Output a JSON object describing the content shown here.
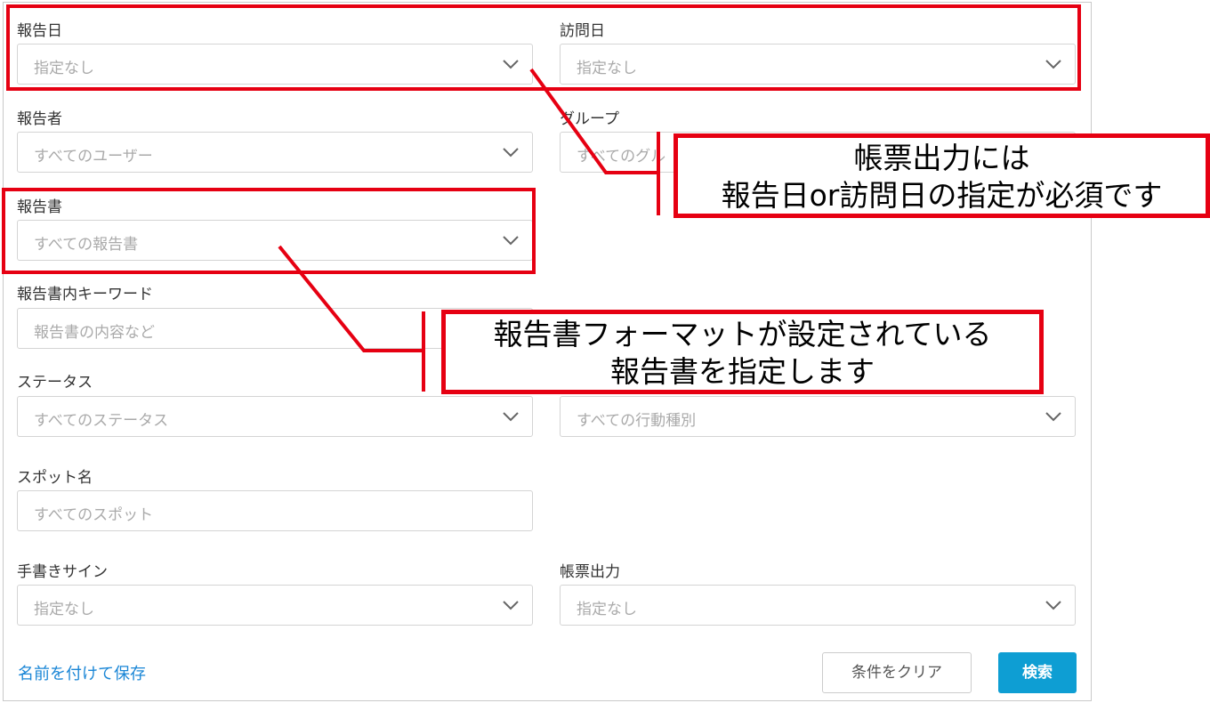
{
  "fields": {
    "report_date": {
      "label": "報告日",
      "placeholder": "指定なし"
    },
    "visit_date": {
      "label": "訪問日",
      "placeholder": "指定なし"
    },
    "reporter": {
      "label": "報告者",
      "placeholder": "すべてのユーザー"
    },
    "group": {
      "label": "グループ",
      "placeholder": "すべてのグル"
    },
    "report": {
      "label": "報告書",
      "placeholder": "すべての報告書"
    },
    "keyword": {
      "label": "報告書内キーワード",
      "placeholder": "報告書の内容など"
    },
    "status": {
      "label": "ステータス",
      "placeholder": "すべてのステータス"
    },
    "action_type": {
      "placeholder": "すべての行動種別"
    },
    "spot_name": {
      "label": "スポット名",
      "placeholder": "すべてのスポット"
    },
    "signature": {
      "label": "手書きサイン",
      "placeholder": "指定なし"
    },
    "form_output": {
      "label": "帳票出力",
      "placeholder": "指定なし"
    }
  },
  "actions": {
    "save_named": "名前を付けて保存",
    "clear": "条件をクリア",
    "search": "検索"
  },
  "annotations": {
    "date_note": {
      "line1": "帳票出力には",
      "line2": "報告日or訪問日の指定が必須です"
    },
    "report_note": {
      "line1": "報告書フォーマットが設定されている",
      "line2": "報告書を指定します"
    }
  },
  "colors": {
    "annotation_red": "#e60012",
    "primary_button": "#0e9ed3",
    "link": "#1a86d6"
  }
}
